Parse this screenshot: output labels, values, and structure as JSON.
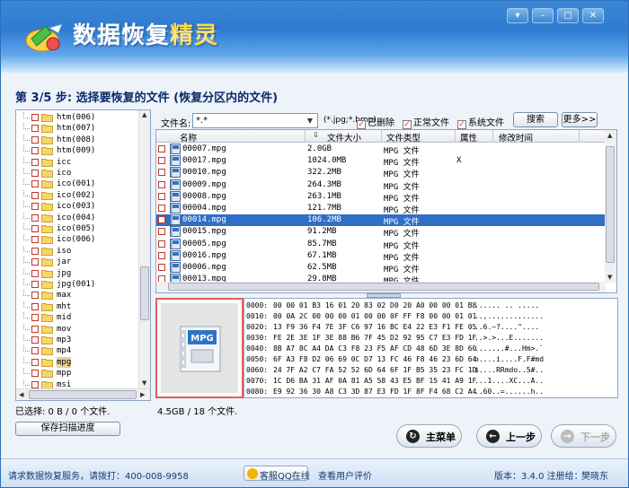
{
  "app": {
    "title_main": "数据恢复",
    "title_highlight": "精灵",
    "window_controls": [
      "▾",
      "–",
      "□",
      "✕"
    ]
  },
  "step": {
    "text": "第 3/5 步: 选择要恢复的文件 (恢复分区内的文件)"
  },
  "tree": {
    "items": [
      {
        "label": "htm(006)"
      },
      {
        "label": "htm(007)"
      },
      {
        "label": "htm(008)"
      },
      {
        "label": "htm(009)"
      },
      {
        "label": "icc"
      },
      {
        "label": "ico"
      },
      {
        "label": "ico(001)"
      },
      {
        "label": "ico(002)"
      },
      {
        "label": "ico(003)"
      },
      {
        "label": "ico(004)"
      },
      {
        "label": "ico(005)"
      },
      {
        "label": "ico(006)"
      },
      {
        "label": "iso"
      },
      {
        "label": "jar"
      },
      {
        "label": "jpg"
      },
      {
        "label": "jpg(001)"
      },
      {
        "label": "max"
      },
      {
        "label": "mht"
      },
      {
        "label": "mid"
      },
      {
        "label": "mov"
      },
      {
        "label": "mp3"
      },
      {
        "label": "mp4"
      },
      {
        "label": "mpg"
      },
      {
        "label": "mpp"
      },
      {
        "label": "msi"
      }
    ],
    "selected_index": 22
  },
  "filter": {
    "label": "文件名:",
    "value": "*.*",
    "example": "(*.jpg;*.bmp)",
    "deleted_label": "已删除",
    "normal_label": "正常文件",
    "system_label": "系统文件",
    "search_label": "搜索",
    "more_label": "更多>>"
  },
  "file_list": {
    "columns": [
      "名称",
      "文件大小",
      "文件类型",
      "属性",
      "修改时间"
    ],
    "rows": [
      {
        "name": "00007.mpg",
        "size": "2.0GB",
        "type": "MPG 文件",
        "attr": "",
        "mtime": ""
      },
      {
        "name": "00017.mpg",
        "size": "1024.0MB",
        "type": "MPG 文件",
        "attr": "X",
        "mtime": ""
      },
      {
        "name": "00010.mpg",
        "size": "322.2MB",
        "type": "MPG 文件",
        "attr": "",
        "mtime": ""
      },
      {
        "name": "00009.mpg",
        "size": "264.3MB",
        "type": "MPG 文件",
        "attr": "",
        "mtime": ""
      },
      {
        "name": "00008.mpg",
        "size": "263.1MB",
        "type": "MPG 文件",
        "attr": "",
        "mtime": ""
      },
      {
        "name": "00004.mpg",
        "size": "121.7MB",
        "type": "MPG 文件",
        "attr": "",
        "mtime": ""
      },
      {
        "name": "00014.mpg",
        "size": "106.2MB",
        "type": "MPG 文件",
        "attr": "",
        "mtime": ""
      },
      {
        "name": "00015.mpg",
        "size": "91.2MB",
        "type": "MPG 文件",
        "attr": "",
        "mtime": ""
      },
      {
        "name": "00005.mpg",
        "size": "85.7MB",
        "type": "MPG 文件",
        "attr": "",
        "mtime": ""
      },
      {
        "name": "00016.mpg",
        "size": "67.1MB",
        "type": "MPG 文件",
        "attr": "",
        "mtime": ""
      },
      {
        "name": "00006.mpg",
        "size": "62.5MB",
        "type": "MPG 文件",
        "attr": "",
        "mtime": ""
      },
      {
        "name": "00013.mpg",
        "size": "29.8MB",
        "type": "MPG 文件",
        "attr": "",
        "mtime": ""
      }
    ],
    "selected_index": 6
  },
  "preview": {
    "label": "MPG"
  },
  "hex": {
    "rows": [
      {
        "off": "0000:",
        "bytes": "00 00 01 B3 16 01 20 83 02 D0 20 A0 00 00 01 B8",
        "asc": "...... .. ....."
      },
      {
        "off": "0010:",
        "bytes": "00 0A 2C 00 00 00 01 00 00 0F FF F8 00 00 01 01",
        "asc": "..,............."
      },
      {
        "off": "0020:",
        "bytes": "13 F9 36 F4 7E 3F C6 97 16 BC E4 22 E3 F1 FE 05",
        "asc": "..6.~?....\"...."
      },
      {
        "off": "0030:",
        "bytes": "FE 2E 3E 1F 3E 88 B6 7F 45 D2 92 95 C7 E3 FD 1F",
        "asc": "..>.>...E......."
      },
      {
        "off": "0040:",
        "bytes": "8B A7 8C A4 DA C3 F8 23 F5 AF CD 48 6D 3E 8D 60",
        "asc": ".......#...Hm>.`"
      },
      {
        "off": "0050:",
        "bytes": "6F A3 F8 D2 06 69 0C D7 13 FC 46 F8 46 23 6D 64",
        "asc": "o....i....F.F#md"
      },
      {
        "off": "0060:",
        "bytes": "24 7F A2 C7 FA 52 52 6D 64 6F 1F B5 35 23 FC 1D",
        "asc": "$....RRmdo..5#.."
      },
      {
        "off": "0070:",
        "bytes": "1C D6 BA 31 AF 0A 81 A5 58 43 E5 BF 15 41 A9 1F",
        "asc": "...1....XC...A.."
      },
      {
        "off": "0080:",
        "bytes": "E9 92 36 30 A8 C3 3D 87 E3 FD 1F 8F F4 68 C2 A4",
        "asc": "..60..=......h.."
      }
    ]
  },
  "status": {
    "selected": "已选择: 0 B / 0 个文件.",
    "total": "4.5GB / 18 个文件."
  },
  "buttons": {
    "save_progress": "保存扫描进度",
    "main_menu": "主菜单",
    "prev": "上一步",
    "next": "下一步"
  },
  "footer": {
    "service": "请求数据恢复服务，请拨打：400-008-9958",
    "qq": "客服QQ在线",
    "reviews": "查看用户评价",
    "version": "版本：3.4.0 注册给：",
    "user": "樊晓东"
  }
}
